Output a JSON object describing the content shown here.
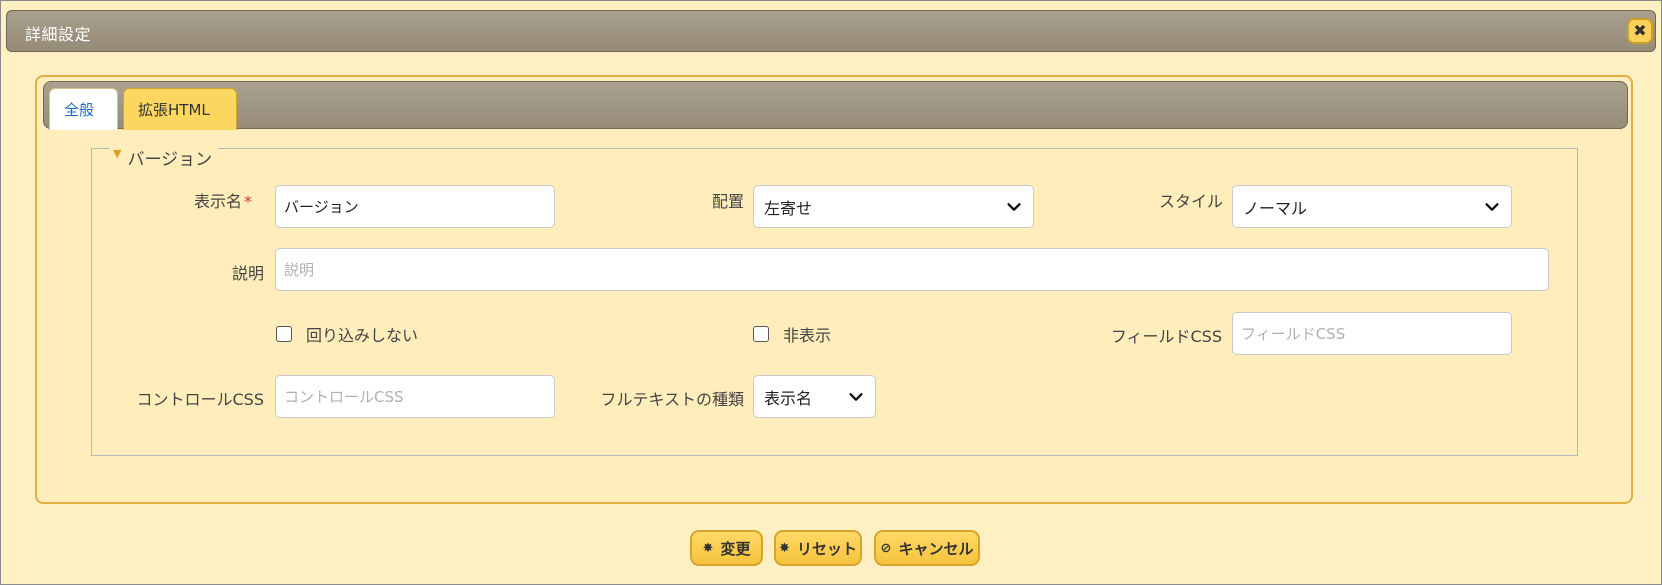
{
  "dialog": {
    "title": "詳細設定",
    "close_icon": "close-icon"
  },
  "tabs": [
    {
      "label": "全般"
    },
    {
      "label": "拡張HTML"
    }
  ],
  "group": {
    "legend": "バージョン"
  },
  "fields": {
    "display_name": {
      "label": "表示名",
      "required_mark": "*",
      "value": "バージョン"
    },
    "align": {
      "label": "配置",
      "value": "左寄せ"
    },
    "style": {
      "label": "スタイル",
      "value": "ノーマル"
    },
    "description": {
      "label": "説明",
      "placeholder": "説明",
      "value": ""
    },
    "no_wrap": {
      "label": "回り込みしない",
      "checked": false
    },
    "hidden": {
      "label": "非表示",
      "checked": false
    },
    "field_css": {
      "label": "フィールドCSS",
      "placeholder": "フィールドCSS"
    },
    "control_css": {
      "label": "コントロールCSS",
      "placeholder": "コントロールCSS"
    },
    "fulltext_type": {
      "label": "フルテキストの種類",
      "value": "表示名"
    }
  },
  "buttons": {
    "change": {
      "label": "変更",
      "icon": "gear-icon"
    },
    "reset": {
      "label": "リセット",
      "icon": "gear-icon"
    },
    "cancel": {
      "label": "キャンセル",
      "icon": "cancel-icon"
    }
  }
}
